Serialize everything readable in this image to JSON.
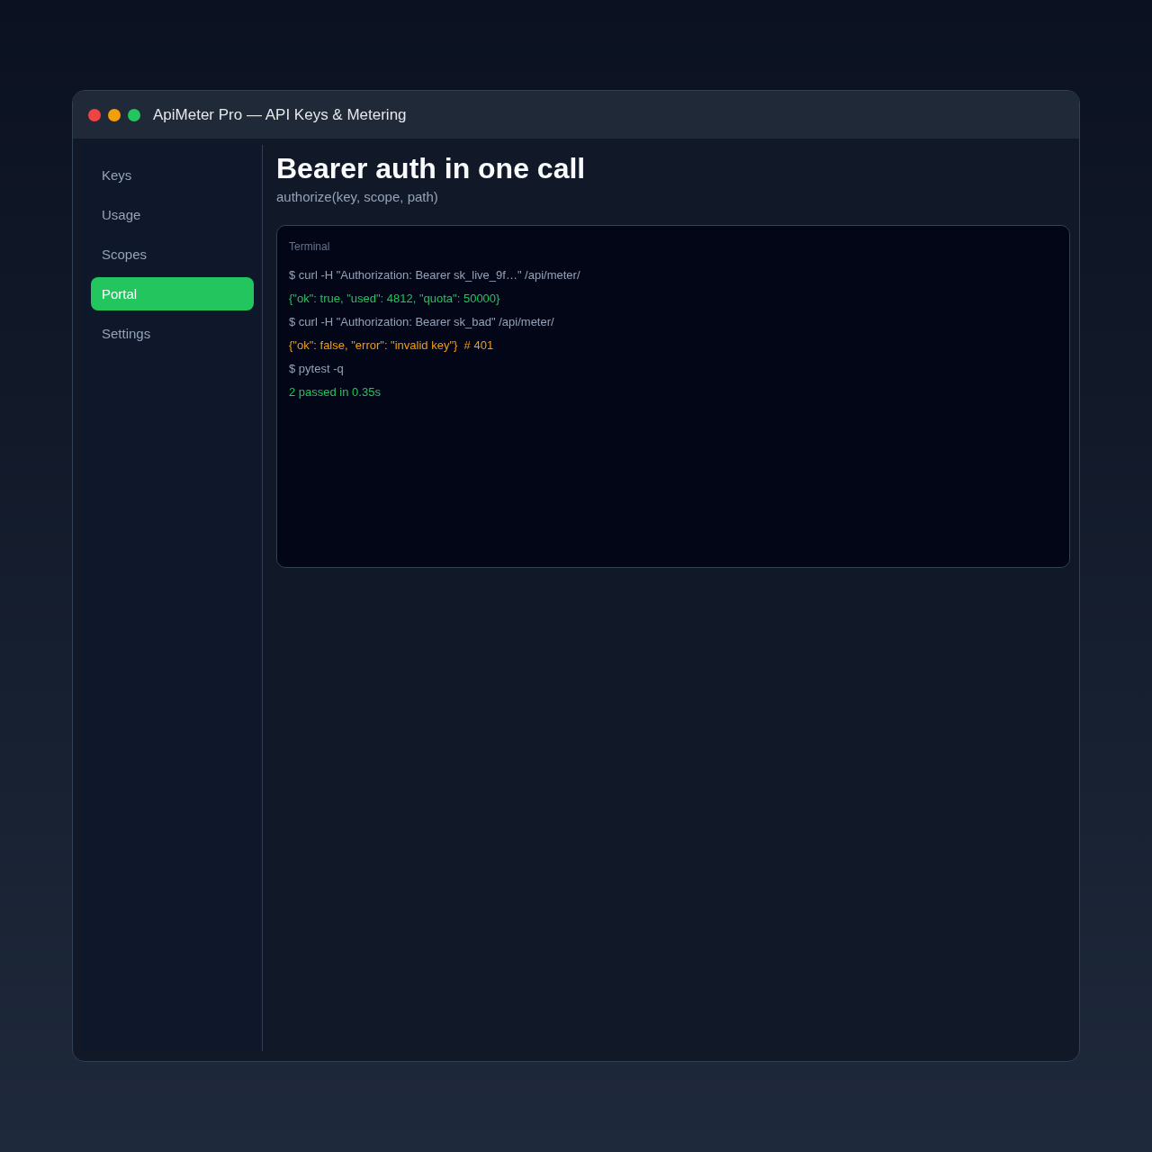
{
  "window": {
    "title": "ApiMeter Pro — API Keys & Metering",
    "controls": [
      {
        "color": "#ef4444"
      },
      {
        "color": "#f59e0b"
      },
      {
        "color": "#22c55e"
      }
    ]
  },
  "sidebar": {
    "items": [
      {
        "label": "Keys",
        "selected": false
      },
      {
        "label": "Usage",
        "selected": false
      },
      {
        "label": "Scopes",
        "selected": false
      },
      {
        "label": "Portal",
        "selected": true
      },
      {
        "label": "Settings",
        "selected": false
      }
    ]
  },
  "main": {
    "title": "Bearer auth in one call",
    "subtitle": "authorize(key, scope, path)"
  },
  "terminal": {
    "title": "Terminal",
    "lines": [
      {
        "kind": "command",
        "text": "$ curl -H \"Authorization: Bearer sk_live_9f…\" /api/meter/"
      },
      {
        "kind": "success",
        "text": "{\"ok\": true, \"used\": 4812, \"quota\": 50000}"
      },
      {
        "kind": "command",
        "text": "$ curl -H \"Authorization: Bearer sk_bad\" /api/meter/"
      },
      {
        "kind": "error",
        "text": "{\"ok\": false, \"error\": \"invalid key\"}  # 401"
      },
      {
        "kind": "command",
        "text": "$ pytest -q"
      },
      {
        "kind": "success",
        "text": "2 passed in 0.35s"
      }
    ]
  }
}
